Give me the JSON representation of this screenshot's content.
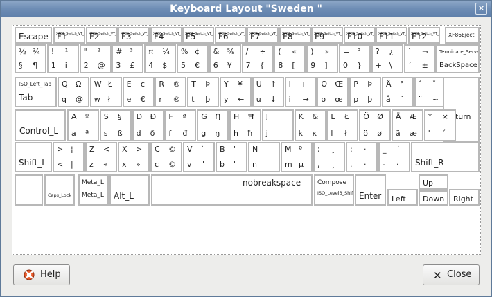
{
  "window": {
    "title": "Keyboard Layout \"Sweden \"",
    "close_glyph": "✕"
  },
  "keys": {
    "esc": "Escape",
    "f": [
      {
        "vt": "XF86_Switch_VT_1",
        "label": "F1"
      },
      {
        "vt": "XF86_Switch_VT_2",
        "label": "F2"
      },
      {
        "vt": "XF86_Switch_VT_3",
        "label": "F3"
      },
      {
        "vt": "XF86_Switch_VT_4",
        "label": "F4"
      },
      {
        "vt": "XF86_Switch_VT_5",
        "label": "F5"
      },
      {
        "vt": "XF86_Switch_VT_6",
        "label": "F6"
      },
      {
        "vt": "XF86_Switch_VT_7",
        "label": "F7"
      },
      {
        "vt": "XF86_Switch_VT_8",
        "label": "F8"
      },
      {
        "vt": "XF86_Switch_VT_9",
        "label": "F9"
      },
      {
        "vt": "XF86_Switch_VT_10",
        "label": "F10"
      },
      {
        "vt": "XF86_Switch_VT_11",
        "label": "F11"
      },
      {
        "vt": "XF86_Switch_VT_12",
        "label": "F12"
      }
    ],
    "eject": "XF86Eject",
    "num": [
      [
        "½",
        "¾",
        "§",
        "¶"
      ],
      [
        "!",
        "¹",
        "1",
        "i"
      ],
      [
        "\"",
        "²",
        "2",
        "@"
      ],
      [
        "#",
        "³",
        "3",
        "£"
      ],
      [
        "¤",
        "¼",
        "4",
        "$"
      ],
      [
        "%",
        "¢",
        "5",
        "€"
      ],
      [
        "&",
        "⅝",
        "6",
        "¥"
      ],
      [
        "/",
        "÷",
        "7",
        "{"
      ],
      [
        "(",
        "«",
        "8",
        "["
      ],
      [
        ")",
        "»",
        "9",
        "]"
      ],
      [
        "=",
        "°",
        "0",
        "}"
      ],
      [
        "?",
        "¿",
        "+",
        "\\"
      ],
      [
        "`",
        "¬",
        "´",
        "±"
      ]
    ],
    "backspace_top": "Terminate_Server",
    "backspace": "BackSpace",
    "tab_top": "ISO_Left_Tab",
    "tab": "Tab",
    "row_q": [
      [
        "Q",
        "Ω",
        "q",
        "@"
      ],
      [
        "W",
        "Ł",
        "w",
        "ł"
      ],
      [
        "E",
        "¢",
        "e",
        "€"
      ],
      [
        "R",
        "®",
        "r",
        "®"
      ],
      [
        "T",
        "Þ",
        "t",
        "þ"
      ],
      [
        "Y",
        "¥",
        "y",
        "←"
      ],
      [
        "U",
        "↑",
        "u",
        "↓"
      ],
      [
        "I",
        "ı",
        "i",
        "→"
      ],
      [
        "O",
        "Œ",
        "o",
        "œ"
      ],
      [
        "P",
        "Þ",
        "p",
        "þ"
      ],
      [
        "Å",
        "°",
        "å",
        "¨"
      ],
      [
        "ˆ",
        "ˇ",
        "¨",
        "~"
      ]
    ],
    "caps": "Control_L",
    "row_a": [
      [
        "A",
        "º",
        "a",
        "ª"
      ],
      [
        "S",
        "§",
        "s",
        "ß"
      ],
      [
        "D",
        "Ð",
        "d",
        "ð"
      ],
      [
        "F",
        "ª",
        "f",
        "đ"
      ],
      [
        "G",
        "Ŋ",
        "g",
        "ŋ"
      ],
      [
        "H",
        "Ħ",
        "h",
        "ħ"
      ],
      [
        "J",
        "",
        "j",
        ""
      ],
      [
        "K",
        "&",
        "k",
        "ĸ"
      ],
      [
        "L",
        "Ł",
        "l",
        "ł"
      ],
      [
        "Ö",
        "Ø",
        "ö",
        "ø"
      ],
      [
        "Ä",
        "Æ",
        "ä",
        "æ"
      ],
      [
        "*",
        "×",
        "'",
        "´"
      ]
    ],
    "return": "Return",
    "shift_l": "Shift_L",
    "row_z": [
      [
        ">",
        "¦",
        "<",
        "|"
      ],
      [
        "Z",
        "<",
        "z",
        "«"
      ],
      [
        "X",
        ">",
        "x",
        "»"
      ],
      [
        "C",
        "©",
        "c",
        "©"
      ],
      [
        "V",
        "`",
        "v",
        "\""
      ],
      [
        "B",
        "'",
        "b",
        "\""
      ],
      [
        "N",
        "",
        "n",
        ""
      ],
      [
        "M",
        "º",
        "m",
        "µ"
      ],
      [
        ";",
        "¸",
        ",",
        "¸"
      ],
      [
        ":",
        "·",
        ".",
        "·"
      ],
      [
        "_",
        "˙",
        "-",
        "·"
      ]
    ],
    "shift_r": "Shift_R",
    "caps_lock": "Caps_Lock",
    "meta_top": "Meta_L",
    "meta": "Meta_L",
    "alt": "Alt_L",
    "space": "nobreakspace",
    "compose": "Compose",
    "level3": "ISO_Level3_Shift",
    "enter": "Enter",
    "left": "Left",
    "up": "Up",
    "down": "Down",
    "right": "Right"
  },
  "buttons": {
    "help": "Help",
    "close": "Close"
  }
}
